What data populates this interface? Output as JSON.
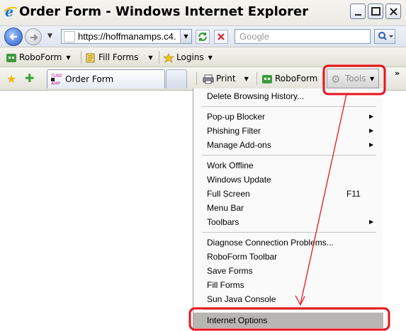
{
  "window": {
    "title": "Order Form - Windows Internet Explorer"
  },
  "address_bar": {
    "url": "https://hoffmanamps.c4.",
    "search_placeholder": "Google"
  },
  "roboform_bar": {
    "items": [
      "RoboForm",
      "Fill Forms",
      "Logins"
    ]
  },
  "tab_bar": {
    "tab_label": "Order Form",
    "print_label": "Print",
    "roboform_label": "RoboForm",
    "tools_label": "Tools"
  },
  "tools_menu": {
    "items": [
      {
        "label": "Delete Browsing History..."
      },
      {
        "label": "Pop-up Blocker"
      },
      {
        "label": "Phishing Filter"
      },
      {
        "label": "Manage Add-ons"
      },
      {
        "label": "Work Offline"
      },
      {
        "label": "Windows Update"
      },
      {
        "label": "Full Screen",
        "shortcut": "F11"
      },
      {
        "label": "Menu Bar"
      },
      {
        "label": "Toolbars"
      },
      {
        "label": "Diagnose Connection Problems..."
      },
      {
        "label": "RoboForm Toolbar"
      },
      {
        "label": "Save Forms"
      },
      {
        "label": "Fill Forms"
      },
      {
        "label": "Sun Java Console"
      },
      {
        "label": "Internet Options"
      }
    ],
    "highlighted": "Internet Options"
  },
  "colors": {
    "annotation_red": "#e8141b",
    "menu_highlight": "#b7b6b3"
  }
}
